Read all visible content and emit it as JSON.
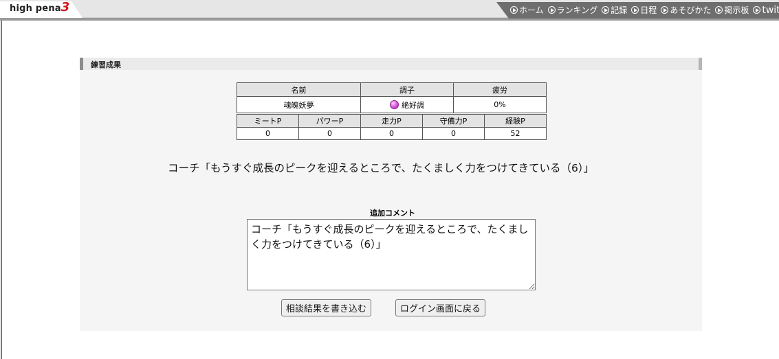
{
  "header": {
    "logo_text": "high pena",
    "logo_number": "3",
    "nav": [
      {
        "label": "ホーム"
      },
      {
        "label": "ランキング"
      },
      {
        "label": "記録"
      },
      {
        "label": "日程"
      },
      {
        "label": "あそびかた"
      },
      {
        "label": "掲示板"
      },
      {
        "label": "twitter"
      }
    ]
  },
  "panel": {
    "title": "練習成果",
    "status_table": {
      "headers": [
        "名前",
        "調子",
        "疲労"
      ],
      "row": {
        "name": "魂魄妖夢",
        "condition": "絶好調",
        "condition_icon": "condition-best-icon",
        "fatigue": "0%"
      }
    },
    "points_table": {
      "headers": [
        "ミートP",
        "パワーP",
        "走力P",
        "守備力P",
        "経験P"
      ],
      "values": [
        "0",
        "0",
        "0",
        "0",
        "52"
      ]
    },
    "coach_message": "コーチ「もうすぐ成長のピークを迎えるところで、たくましく力をつけてきている（6）」",
    "comment_label": "追加コメント",
    "comment_value": "コーチ「もうすぐ成長のピークを迎えるところで、たくましく力をつけてきている（6）」",
    "buttons": {
      "write": "相談結果を書き込む",
      "back": "ログイン画面に戻る"
    }
  },
  "colors": {
    "nav_bg": "#6e6e6e",
    "logo_accent": "#d11a1a",
    "panel_bg": "#f5f5f5",
    "table_header_bg": "#e3e3e3"
  }
}
